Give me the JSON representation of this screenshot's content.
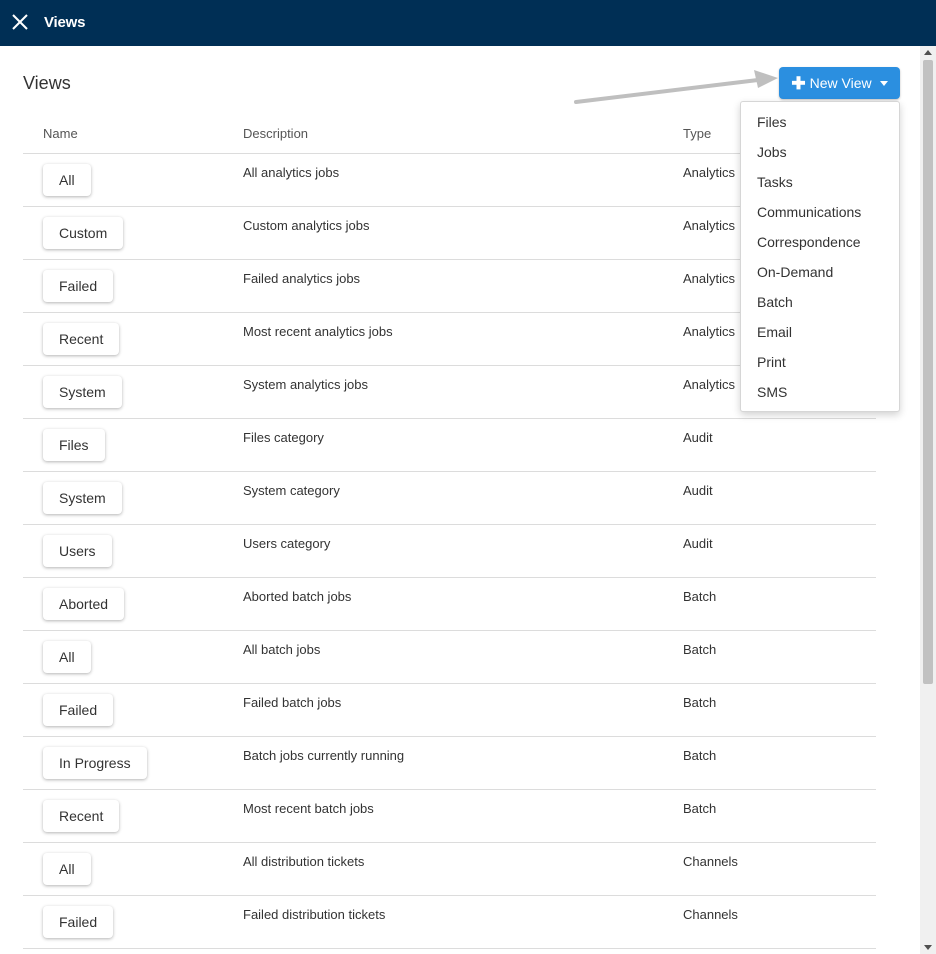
{
  "header": {
    "title": "Views",
    "close_icon": "close-icon"
  },
  "page": {
    "title": "Views"
  },
  "new_view_button": {
    "label": "New View",
    "plus": "✚",
    "accent": "#2b8fe0"
  },
  "columns": {
    "name": "Name",
    "description": "Description",
    "type": "Type"
  },
  "rows": [
    {
      "name": "All",
      "description": "All analytics jobs",
      "type": "Analytics"
    },
    {
      "name": "Custom",
      "description": "Custom analytics jobs",
      "type": "Analytics"
    },
    {
      "name": "Failed",
      "description": "Failed analytics jobs",
      "type": "Analytics"
    },
    {
      "name": "Recent",
      "description": "Most recent analytics jobs",
      "type": "Analytics"
    },
    {
      "name": "System",
      "description": "System analytics jobs",
      "type": "Analytics"
    },
    {
      "name": "Files",
      "description": "Files category",
      "type": "Audit"
    },
    {
      "name": "System",
      "description": "System category",
      "type": "Audit"
    },
    {
      "name": "Users",
      "description": "Users category",
      "type": "Audit"
    },
    {
      "name": "Aborted",
      "description": "Aborted batch jobs",
      "type": "Batch"
    },
    {
      "name": "All",
      "description": "All batch jobs",
      "type": "Batch"
    },
    {
      "name": "Failed",
      "description": "Failed batch jobs",
      "type": "Batch"
    },
    {
      "name": "In Progress",
      "description": "Batch jobs currently running",
      "type": "Batch"
    },
    {
      "name": "Recent",
      "description": "Most recent batch jobs",
      "type": "Batch"
    },
    {
      "name": "All",
      "description": "All distribution tickets",
      "type": "Channels"
    },
    {
      "name": "Failed",
      "description": "Failed distribution tickets",
      "type": "Channels"
    }
  ],
  "dropdown": {
    "items": [
      "Files",
      "Jobs",
      "Tasks",
      "Communications",
      "Correspondence",
      "On-Demand",
      "Batch",
      "Email",
      "Print",
      "SMS"
    ]
  },
  "colors": {
    "header_bg": "#002f55",
    "arrow": "#bfbfbf"
  }
}
